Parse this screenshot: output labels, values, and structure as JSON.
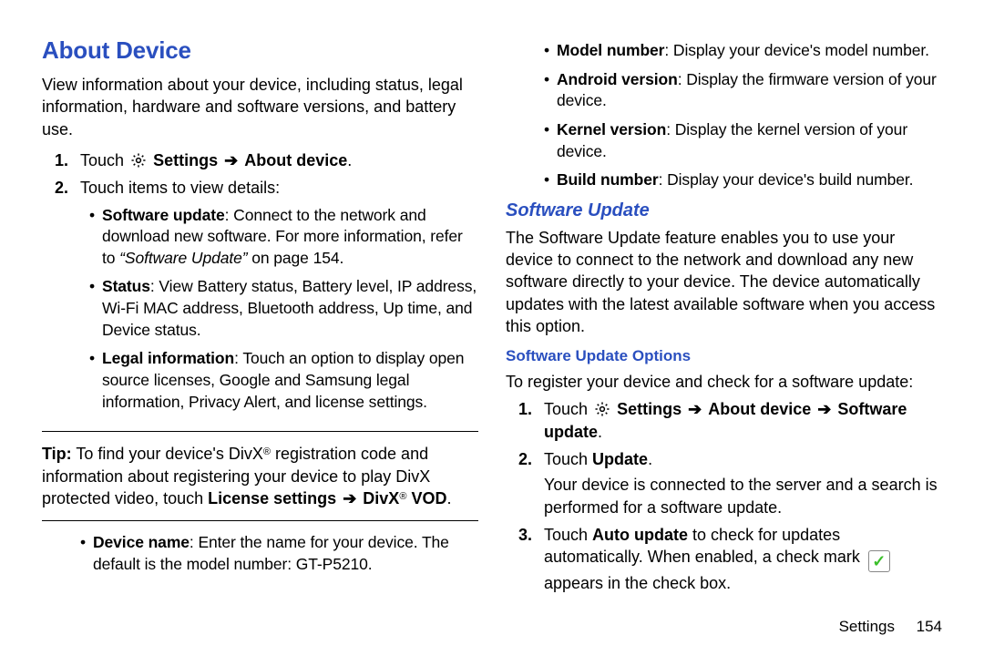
{
  "left": {
    "heading": "About Device",
    "intro": "View information about your device, including status, legal information, hardware and software versions, and battery use.",
    "step1_touch": "Touch",
    "step1_settings": "Settings",
    "step1_about": "About device",
    "step1_period": ".",
    "step2": "Touch items to view details:",
    "bullets1": {
      "sw_label": "Software update",
      "sw_rest_a": ": Connect to the network and download new software. For more information, refer to ",
      "sw_ref": "“Software Update”",
      "sw_rest_b": " on page 154.",
      "status_label": "Status",
      "status_rest": ": View Battery status, Battery level, IP address, Wi-Fi MAC address, Bluetooth address, Up time, and Device status.",
      "legal_label": "Legal information",
      "legal_rest": ": Touch an option to display open source licenses, Google and Samsung legal information, Privacy Alert, and license settings."
    },
    "tip_label": "Tip:",
    "tip_a": " To find your device's DivX",
    "tip_b": " registration code and information about registering your device to play DivX protected video, touch ",
    "tip_path1": "License settings",
    "tip_path2": "DivX",
    "tip_path3": "VOD",
    "bullets2": {
      "devname_label": "Device name",
      "devname_rest": ": Enter the name for your device. The default is the model number: GT-P5210."
    }
  },
  "right": {
    "bullets_top": {
      "model_label": "Model number",
      "model_rest": ": Display your device's model number.",
      "android_label": "Android version",
      "android_rest": ": Display the firmware version of your device.",
      "kernel_label": "Kernel version",
      "kernel_rest": ": Display the kernel version of your device.",
      "build_label": "Build number",
      "build_rest": ": Display your device's build number."
    },
    "h2": "Software Update",
    "swu_intro": "The Software Update feature enables you to use your device to connect to the network and download any new software directly to your device. The device automatically updates with the latest available software when you access this option.",
    "h3": "Software Update Options",
    "reg_intro": "To register your device and check for a software update:",
    "step1_touch": "Touch",
    "step1_settings": "Settings",
    "step1_about": "About device",
    "step1_sw": "Software update",
    "step1_period": ".",
    "step2_a": "Touch ",
    "step2_update": "Update",
    "step2_b": ".",
    "step2_desc": "Your device is connected to the server and a search is performed for a software update.",
    "step3_a": "Touch ",
    "step3_auto": "Auto update",
    "step3_b": " to check for updates automatically. When enabled, a check mark ",
    "step3_c": " appears in the check box."
  },
  "nums": {
    "n1": "1.",
    "n2": "2.",
    "n3": "3."
  },
  "dot": "•",
  "arrow": "➔",
  "reg": "®",
  "footer_section": "Settings",
  "footer_page": "154"
}
